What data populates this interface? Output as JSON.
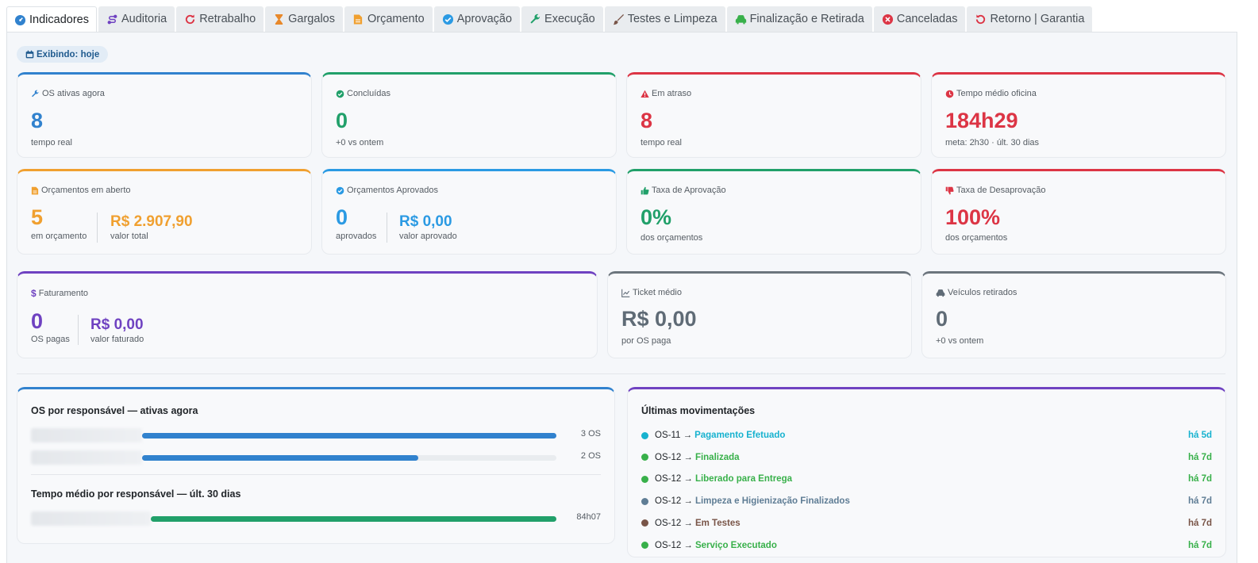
{
  "tabs": [
    {
      "label": "Indicadores",
      "icon": "dashboard-icon",
      "color": "#3182ce",
      "active": true
    },
    {
      "label": "Auditoria",
      "icon": "route-icon",
      "color": "#6f42c1"
    },
    {
      "label": "Retrabalho",
      "icon": "redo-icon",
      "color": "#dc3545"
    },
    {
      "label": "Gargalos",
      "icon": "hourglass-icon",
      "color": "#e8882a"
    },
    {
      "label": "Orçamento",
      "icon": "file-icon",
      "color": "#f0a030"
    },
    {
      "label": "Aprovação",
      "icon": "check-circle-icon",
      "color": "#2b9ae3"
    },
    {
      "label": "Execução",
      "icon": "wrench-icon",
      "color": "#21a06a"
    },
    {
      "label": "Testes e Limpeza",
      "icon": "brush-icon",
      "color": "#795548"
    },
    {
      "label": "Finalização e Retirada",
      "icon": "car-icon",
      "color": "#38b04a"
    },
    {
      "label": "Canceladas",
      "icon": "x-circle-icon",
      "color": "#dc3545"
    },
    {
      "label": "Retorno | Garantia",
      "icon": "undo-icon",
      "color": "#dc3545"
    }
  ],
  "filter_pill": "Exibindo: hoje",
  "cards": {
    "os_ativas": {
      "label": "OS ativas agora",
      "value": "8",
      "sub": "tempo real"
    },
    "concluidas": {
      "label": "Concluídas",
      "value": "0",
      "sub": "+0 vs ontem"
    },
    "em_atraso": {
      "label": "Em atraso",
      "value": "8",
      "sub": "tempo real"
    },
    "tempo_medio": {
      "label": "Tempo médio oficina",
      "value": "184h29",
      "sub": "meta: 2h30 · últ. 30 dias"
    },
    "orc_aberto": {
      "label": "Orçamentos em aberto",
      "value": "5",
      "sub": "em orçamento",
      "money": "R$ 2.907,90",
      "money_sub": "valor total"
    },
    "orc_aprovados": {
      "label": "Orçamentos Aprovados",
      "value": "0",
      "sub": "aprovados",
      "money": "R$ 0,00",
      "money_sub": "valor aprovado"
    },
    "taxa_aprov": {
      "label": "Taxa de Aprovação",
      "value": "0%",
      "sub": "dos orçamentos"
    },
    "taxa_desaprov": {
      "label": "Taxa de Desaprovação",
      "value": "100%",
      "sub": "dos orçamentos"
    },
    "faturamento": {
      "label": "Faturamento",
      "value": "0",
      "sub": "OS pagas",
      "money": "R$ 0,00",
      "money_sub": "valor faturado"
    },
    "ticket": {
      "label": "Ticket médio",
      "value": "R$ 0,00",
      "sub": "por OS paga"
    },
    "veiculos": {
      "label": "Veículos retirados",
      "value": "0",
      "sub": "+0 vs ontem"
    }
  },
  "responsavel": {
    "title_ativas": "OS por responsável — ativas agora",
    "ativas": [
      {
        "value_label": "3 OS",
        "fraction": 1.0
      },
      {
        "value_label": "2 OS",
        "fraction": 0.667
      }
    ],
    "title_tempo": "Tempo médio por responsável — últ. 30 dias",
    "tempo": [
      {
        "value_label": "84h07",
        "fraction": 1.0
      }
    ]
  },
  "movimentacoes": {
    "title": "Últimas movimentações",
    "items": [
      {
        "os": "OS-11 →",
        "status": "Pagamento Efetuado",
        "ago": "há 5d",
        "color": "#17b2cf"
      },
      {
        "os": "OS-12 →",
        "status": "Finalizada",
        "ago": "há 7d",
        "color": "#38b04a"
      },
      {
        "os": "OS-12 →",
        "status": "Liberado para Entrega",
        "ago": "há 7d",
        "color": "#38b04a"
      },
      {
        "os": "OS-12 →",
        "status": "Limpeza e Higienização Finalizados",
        "ago": "há 7d",
        "color": "#5f7d95"
      },
      {
        "os": "OS-12 →",
        "status": "Em Testes",
        "ago": "há 7d",
        "color": "#795548"
      },
      {
        "os": "OS-12 →",
        "status": "Serviço Executado",
        "ago": "há 7d",
        "color": "#38b04a"
      }
    ]
  }
}
